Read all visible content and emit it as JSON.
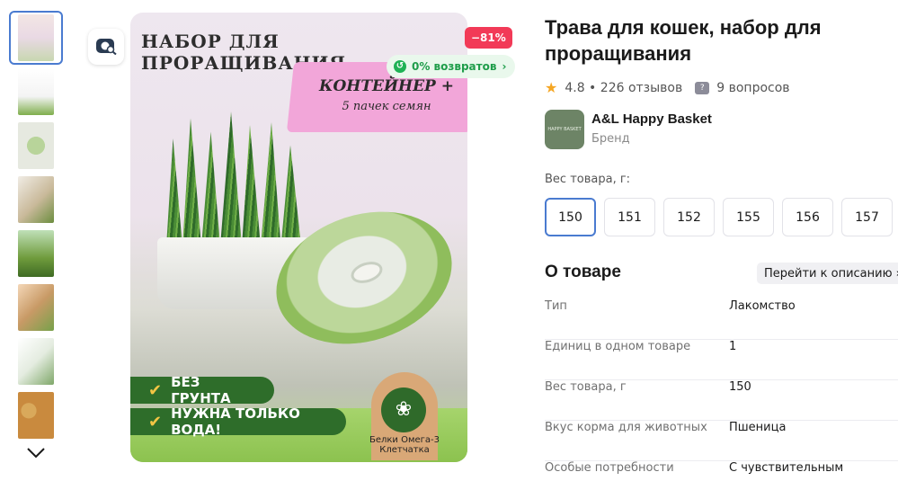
{
  "thumbnails": [
    "thumb-1",
    "thumb-2",
    "thumb-3",
    "thumb-4",
    "thumb-5",
    "thumb-6",
    "thumb-7",
    "thumb-8"
  ],
  "main_image": {
    "header": "НАБОР ДЛЯ ПРОРАЩИВАНИЯ",
    "ribbon_line1": "КОНТЕЙНЕР +",
    "ribbon_line2": "5 пачек семян",
    "badge1": "БЕЗ ГРУНТА",
    "badge2": "НУЖНА ТОЛЬКО ВОДА!",
    "eco_text": "Белки Омега-3 Клетчатка",
    "discount": "−81%",
    "returns": "0% возвратов"
  },
  "product": {
    "title": "Трава для кошек, набор для проращивания",
    "rating": "4.8",
    "reviews": "226 отзывов",
    "questions": "9 вопросов"
  },
  "brand": {
    "logo_text": "HAPPY BASKET",
    "name": "A&L Happy Basket",
    "subtitle": "Бренд"
  },
  "weight": {
    "label": "Вес товара, г:",
    "options": [
      "150",
      "151",
      "152",
      "155",
      "156",
      "157"
    ],
    "selected": "150"
  },
  "about": {
    "title": "О товаре",
    "go_to_description": "Перейти к описанию",
    "specs": [
      {
        "key": "Тип",
        "value": "Лакомство"
      },
      {
        "key": "Единиц в одном товаре",
        "value": "1"
      },
      {
        "key": "Вес товара, г",
        "value": "150"
      },
      {
        "key": "Вкус корма для животных",
        "value": "Пшеница"
      },
      {
        "key": "Особые потребности",
        "value": "С чувствительным"
      }
    ]
  },
  "colors": {
    "accent": "#4a7bd0",
    "discount": "#f23a57",
    "returns": "#1f9d4a",
    "star": "#f5a623"
  }
}
